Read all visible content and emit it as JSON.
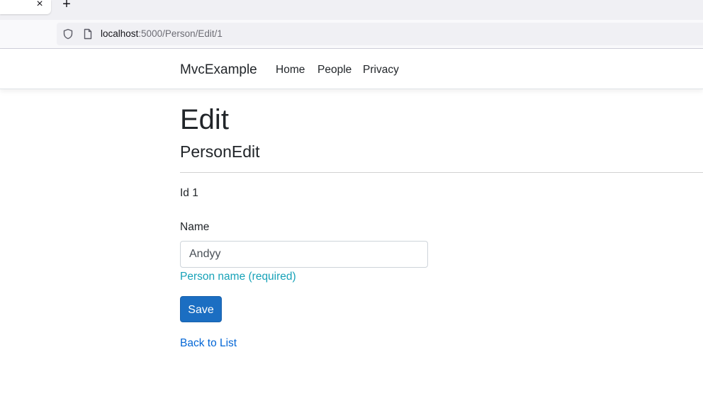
{
  "browser": {
    "tab_close": "×",
    "new_tab": "+",
    "url_host": "localhost",
    "url_rest": ":5000/Person/Edit/1",
    "icons": [
      "shield-icon",
      "page-icon",
      "close-icon",
      "plus-icon"
    ]
  },
  "navbar": {
    "brand": "MvcExample",
    "items": [
      "Home",
      "People",
      "Privacy"
    ]
  },
  "page": {
    "title": "Edit",
    "subtitle": "PersonEdit",
    "id_label": "Id",
    "id_value": "1",
    "name_label": "Name",
    "name_value": "Andyy",
    "name_hint": "Person name (required)",
    "save_label": "Save",
    "back_link": "Back to List"
  },
  "colors": {
    "primary_button": "#1b6ec2",
    "link": "#0366d6",
    "hint": "#17a2b8"
  }
}
